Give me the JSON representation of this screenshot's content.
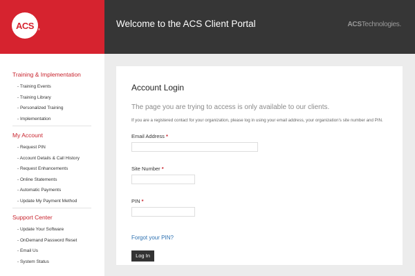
{
  "header": {
    "logo_text": "ACS",
    "logo_reg": "®",
    "title": "Welcome to the ACS Client Portal",
    "brand_bold": "ACS",
    "brand_rest": "Technologies.",
    "accent_color": "#d6232f",
    "bar_color": "#363636"
  },
  "sidebar": {
    "sections": [
      {
        "title": "Training & Implementation",
        "items": [
          "- Training Events",
          "- Training Library",
          "- Personalized Training",
          "- Implementation"
        ]
      },
      {
        "title": "My Account",
        "items": [
          "- Request PIN",
          "- Account Details & Call History",
          "- Request Enhancements",
          "- Online Statements",
          "- Automatic Payments",
          "- Update My Payment Method"
        ]
      },
      {
        "title": "Support Center",
        "items": [
          "- Update Your Software",
          "- OnDemand Password Reset",
          "- Email Us",
          "- System Status"
        ]
      }
    ]
  },
  "login": {
    "title": "Account Login",
    "subtitle": "The page you are trying to access is only available to our clients.",
    "description": "If you are a registered contact for your organization, please log in using your email address, your organization's site number and PIN.",
    "email_label": "Email Address",
    "site_label": "Site Number",
    "pin_label": "PIN",
    "required_mark": "*",
    "forgot_link": "Forgot your PIN?",
    "login_button": "Log In"
  }
}
